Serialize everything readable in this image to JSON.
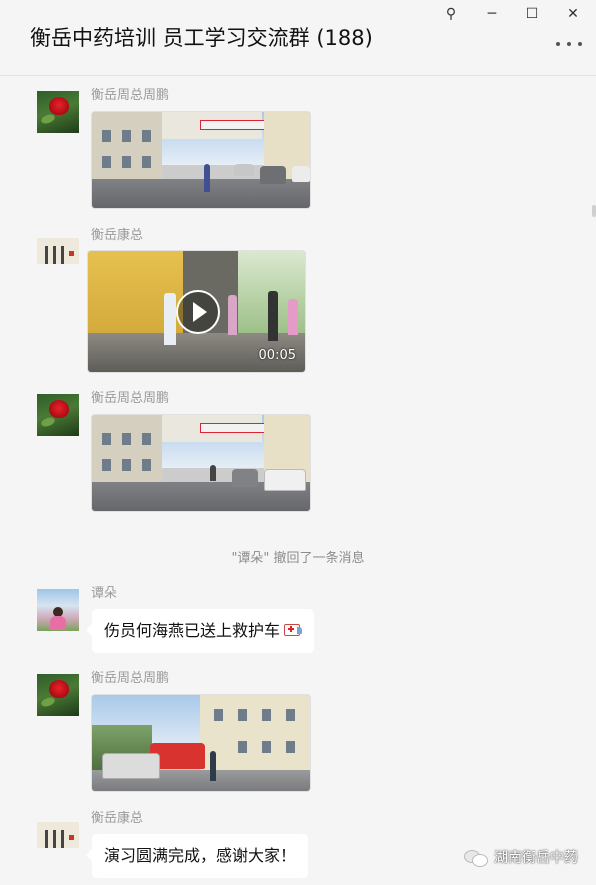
{
  "window": {
    "title": "衡岳中药培训 员工学习交流群 (188)",
    "controls": {
      "pin": "⚲",
      "minimize": "─",
      "maximize": "☐",
      "close": "✕"
    }
  },
  "messages": [
    {
      "sender": "衡岳周总周鹏",
      "type": "image",
      "image": "factory-yard-photo"
    },
    {
      "sender": "衡岳康总",
      "type": "video",
      "duration": "00:05"
    },
    {
      "sender": "衡岳周总周鹏",
      "type": "image",
      "image": "factory-yard-photo"
    },
    {
      "type": "system",
      "text": "\"谭朵\" 撤回了一条消息"
    },
    {
      "sender": "谭朵",
      "type": "text",
      "text": "伤员何海燕已送上救护车",
      "emoji": "ambulance"
    },
    {
      "sender": "衡岳周总周鹏",
      "type": "image",
      "image": "fire-truck-photo"
    },
    {
      "sender": "衡岳康总",
      "type": "text",
      "text": "演习圆满完成，感谢大家！"
    }
  ],
  "watermark": {
    "text": "湖南衡岳中药",
    "icon": "wechat-icon"
  },
  "colors": {
    "background": "#f5f5f5",
    "bubble": "#ffffff",
    "sender": "#9a9a9a"
  }
}
